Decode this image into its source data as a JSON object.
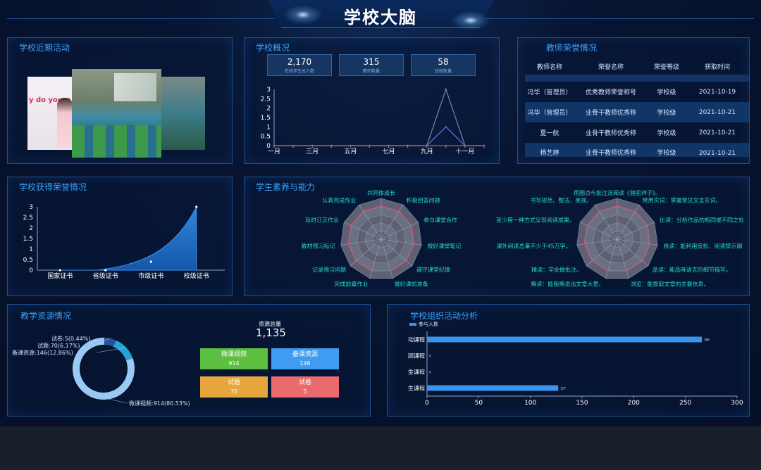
{
  "header": {
    "title": "学校大脑"
  },
  "panels": {
    "activities": {
      "title": "学校近期活动",
      "photo_caption": "y do you u"
    },
    "overview": {
      "title": "学校概况",
      "stats": [
        {
          "value": "2,170",
          "label": "在校学生总人数"
        },
        {
          "value": "315",
          "label": "教师数量"
        },
        {
          "value": "58",
          "label": "班级数量"
        }
      ]
    },
    "teacher_honors": {
      "title": "教师荣誉情况",
      "columns": [
        "教师名称",
        "荣誉名称",
        "荣誉等级",
        "获取时间"
      ],
      "rows": [
        [
          "冯华（管理员）",
          "优秀教师荣誉称号",
          "学校级",
          "2021-10-19"
        ],
        [
          "冯华（管理员）",
          "业骨干教师优秀称",
          "学校级",
          "2021-10-21"
        ],
        [
          "夏一航",
          "业骨干教师优秀称",
          "学校级",
          "2021-10-21"
        ],
        [
          "杨艺婷",
          "业骨干教师优秀称",
          "学校级",
          "2021-10-21"
        ]
      ]
    },
    "school_honors": {
      "title": "学校获得荣誉情况"
    },
    "literacy": {
      "title": "学生素养与能力"
    },
    "resources": {
      "title": "教学资源情况",
      "total_label": "资源总量",
      "total_value": "1,135",
      "tiles": [
        {
          "name": "微课视频",
          "value": "914",
          "color": "#5cbf3f"
        },
        {
          "name": "备课资源",
          "value": "146",
          "color": "#3f9cf0"
        },
        {
          "name": "试题",
          "value": "70",
          "color": "#e6a63c"
        },
        {
          "name": "试卷",
          "value": "5",
          "color": "#ea6b6e"
        }
      ],
      "donut_labels": [
        "试卷:5(0.44%)",
        "试题:70(6.17%)",
        "备课资源:146(12.86%)",
        "微课视频:914(80.53%)"
      ]
    },
    "org_activity": {
      "title": "学校组织活动分析"
    }
  },
  "chart_data": [
    {
      "type": "line",
      "x": [
        "一月",
        "二月",
        "三月",
        "四月",
        "五月",
        "六月",
        "七月",
        "八月",
        "九月",
        "十月",
        "十一月",
        "十二月"
      ],
      "x_tick_labels": [
        "一月",
        "三月",
        "五月",
        "七月",
        "九月",
        "十一月"
      ],
      "ylim": [
        0,
        3
      ],
      "y_ticks": [
        "0",
        "0.5",
        "1",
        "1.5",
        "2",
        "2.5",
        "3"
      ],
      "series": [
        {
          "color": "#6d7fa3",
          "values": [
            0,
            0,
            0,
            0,
            0,
            0,
            0,
            0,
            0,
            3,
            0,
            0
          ]
        },
        {
          "color": "#5a6df0",
          "values": [
            0,
            0,
            0,
            0,
            0,
            0,
            0,
            0,
            0,
            1,
            0,
            0
          ]
        },
        {
          "color": "#e04b4b",
          "values": [
            0,
            0,
            0,
            0,
            0,
            0,
            0,
            0,
            0,
            0,
            0,
            0
          ]
        }
      ]
    },
    {
      "type": "area",
      "categories": [
        "国家证书",
        "省级证书",
        "市级证书",
        "校级证书"
      ],
      "values": [
        0,
        0,
        0.4,
        3
      ],
      "ylim": [
        0,
        3
      ],
      "y_ticks": [
        "0",
        "0.5",
        "1",
        "1.5",
        "2",
        "2.5",
        "3"
      ]
    },
    {
      "type": "radar",
      "indicators": [
        "共同体成长",
        "积极回答问题",
        "参与课堂合作",
        "做好课堂笔记",
        "遵守课堂纪律",
        "做好课前准备",
        "完成前置作业",
        "记录预习问题",
        "教材预习标记",
        "及时订正作业",
        "认真完成作业"
      ]
    },
    {
      "type": "radar",
      "indicators": [
        "用圈点与批注法阅读《骆驼祥子》。",
        "常用实词：掌握常见文言实词。",
        "比读：分析作品的相同或不同之处",
        "自读：能利用旁批、阅读提示圈",
        "品读：能品味语言的细节描写。",
        "浏览：能提取文章的主要信息。",
        "略读：能粗略说出文章大意。",
        "精读：学会做批注。",
        "课外阅读总量不少于45万字。",
        "至少用一种方式呈现阅读成果。",
        "书写规范、整洁、美观。"
      ]
    },
    {
      "type": "pie",
      "slices": [
        {
          "name": "微课视频",
          "value": 914,
          "percent": 80.53,
          "color": "#9ac9f5"
        },
        {
          "name": "备课资源",
          "value": 146,
          "percent": 12.86,
          "color": "#1fa6d8"
        },
        {
          "name": "试题",
          "value": 70,
          "percent": 6.17,
          "color": "#2c4f9a"
        },
        {
          "name": "试卷",
          "value": 5,
          "percent": 0.44,
          "color": "#7cc7f0"
        }
      ]
    },
    {
      "type": "bar",
      "orientation": "horizontal",
      "legend": "参与人数",
      "categories": [
        "动课程",
        "团课程",
        "生课程",
        "生课程"
      ],
      "values": [
        266,
        0,
        0,
        127
      ],
      "value_labels": [
        "266",
        "0",
        "0",
        "127"
      ],
      "xlim": [
        0,
        300
      ],
      "x_ticks": [
        "0",
        "50",
        "100",
        "150",
        "200",
        "250",
        "300"
      ]
    }
  ]
}
